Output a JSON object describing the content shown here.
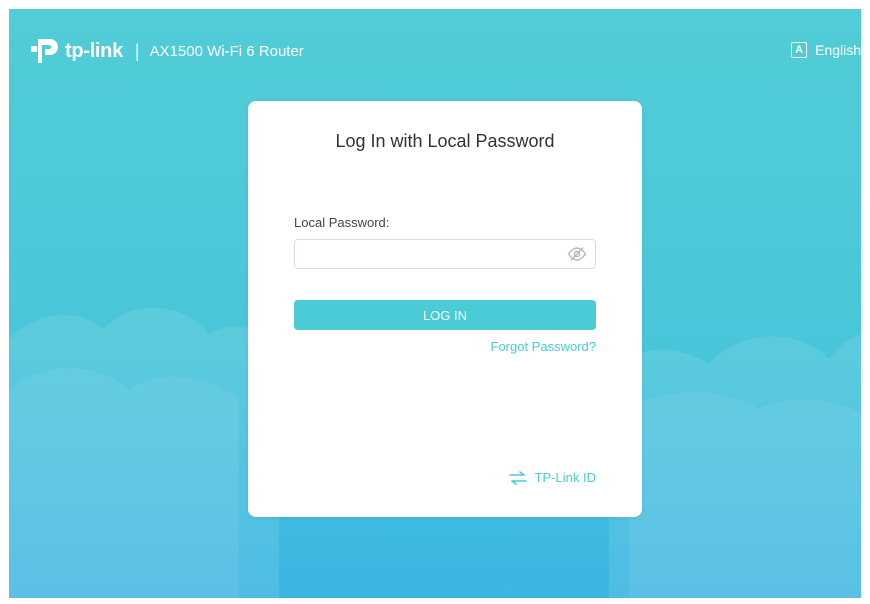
{
  "header": {
    "logo_text": "tp-link",
    "separator": "|",
    "product_name": "AX1500 Wi-Fi 6 Router",
    "language_icon": "A",
    "language_label": "English"
  },
  "login_card": {
    "title": "Log In with Local Password",
    "password_label": "Local Password:",
    "password_value": "",
    "password_placeholder": "",
    "login_button": "LOG IN",
    "forgot_link": "Forgot Password?",
    "tplink_id_link": "TP-Link ID"
  },
  "icons": {
    "logo": "tp-link-logo-icon",
    "language": "language-icon",
    "password_visibility": "eye-slash-icon",
    "tplink_id": "switch-arrows-icon"
  },
  "colors": {
    "background_top": "#52cdd7",
    "background_bottom": "#3bb5e2",
    "accent": "#4acbd6",
    "card": "#ffffff",
    "text": "#333333"
  }
}
